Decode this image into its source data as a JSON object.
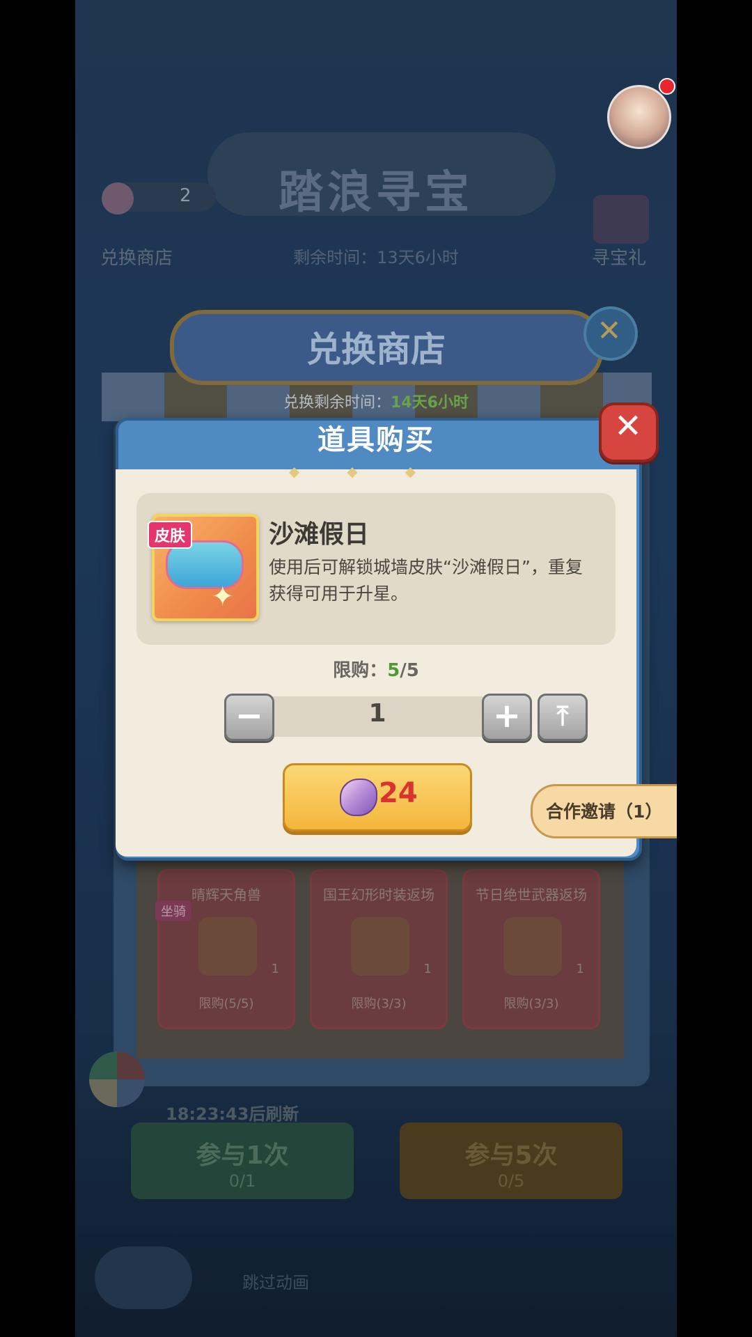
{
  "background": {
    "event_title": "踏浪寻宝",
    "currency_count": "2",
    "exchange_shop_label": "兑换商店",
    "treasure_label": "寻宝礼",
    "remaining_time": "剩余时间：13天6小时",
    "shop_banner": "兑换商店",
    "shop_timer_label": "兑换剩余时间：",
    "shop_timer_value": "14天6小时",
    "cards": [
      {
        "title": "晴辉天角兽",
        "tag": "坐骑",
        "qty": "1",
        "limit": "限购(5/5)"
      },
      {
        "title": "国王幻形时装返场",
        "qty": "1",
        "limit": "限购(3/3)"
      },
      {
        "title": "节日绝世武器返场",
        "qty": "1",
        "limit": "限购(3/3)"
      }
    ],
    "countdown": "18:23:43后刷新",
    "btn_once": "参与1次",
    "btn_once_sub": "0/1",
    "btn_five": "参与5次",
    "btn_five_sub": "0/5",
    "skip_label": "跳过动画"
  },
  "modal": {
    "title": "道具购买",
    "item": {
      "tag": "皮肤",
      "name": "沙滩假日",
      "description": "使用后可解锁城墙皮肤“沙滩假日”，重复获得可用于升星。"
    },
    "limit_label": "限购：",
    "limit_current": "5",
    "limit_total": "/5",
    "quantity": "1",
    "price": "24",
    "icons": {
      "minus": "minus-icon",
      "plus": "plus-icon",
      "max": "max-icon",
      "close": "close-icon",
      "currency": "shell-icon"
    }
  },
  "invite": {
    "label": "合作邀请（1）"
  }
}
